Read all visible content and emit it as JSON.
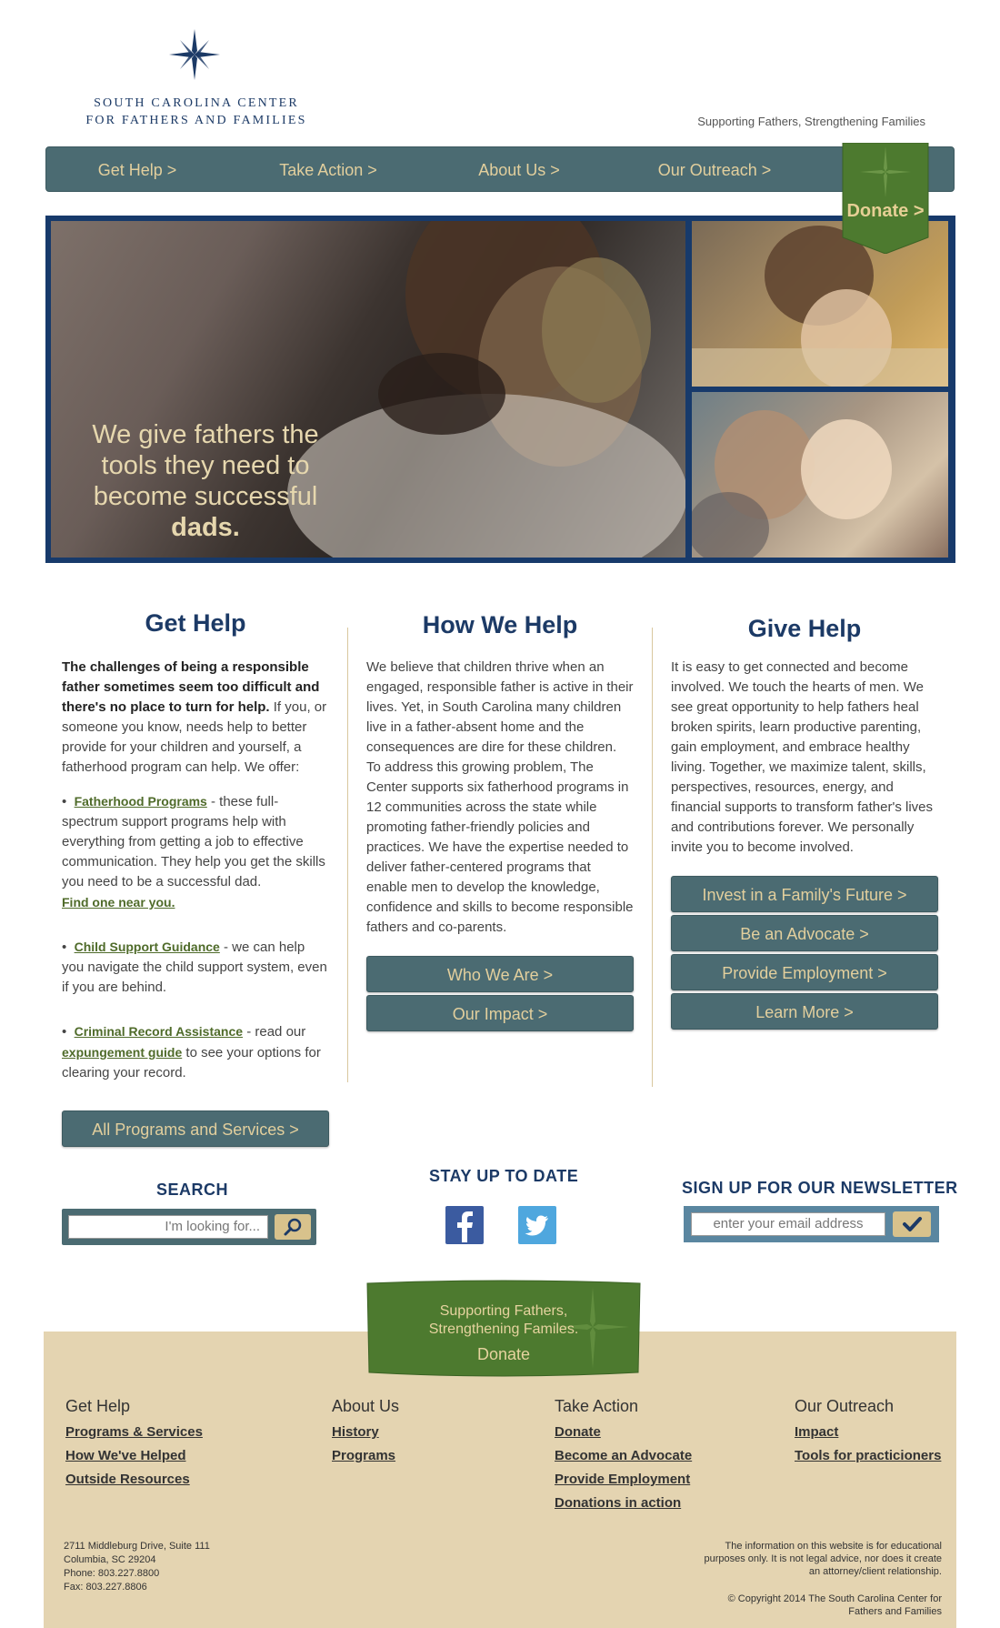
{
  "logo": {
    "line1": "SOUTH CAROLINA CENTER",
    "line2": "FOR FATHERS AND FAMILIES"
  },
  "tagline": "Supporting Fathers, Strengthening Families",
  "nav": {
    "items": [
      "Get Help >",
      "Take Action >",
      "About Us >",
      "Our Outreach >"
    ],
    "donate": "Donate >"
  },
  "hero": {
    "caption": "We give fathers the tools they need to become successful",
    "caption_bold": "dads."
  },
  "get_help": {
    "title": "Get Help",
    "intro_bold": "The challenges of being a responsible father sometimes seem too difficult and there's no place to turn for help.",
    "intro_rest": " If you, or someone you know, needs help to better provide for your children and yourself, a fatherhood program can help.  We offer:",
    "b1_link": "Fatherhood Programs",
    "b1_text": " - these full-spectrum support programs help with everything from getting a job to effective communication.  They help you get the skills you need to be a successful dad.",
    "b1_link2": "Find one near you.",
    "b2_link": "Child Support Guidance",
    "b2_text": " - we can help you navigate the child support system, even if you are behind.",
    "b3_link": "Criminal Record Assistance",
    "b3_text": " - read our ",
    "b3_link2": "expungement guide",
    "b3_text2": " to see your options for clearing your record.",
    "button": "All Programs and Services >"
  },
  "how_we_help": {
    "title": "How We Help",
    "body": "We believe that children thrive when an engaged, responsible father is active in their lives. Yet, in South Carolina many children live in a father-absent home and the consequences are dire for these children. To address this growing problem, The Center supports six fatherhood programs in 12 communities across the state while promoting father-friendly policies and practices.  We have the expertise needed to deliver father-centered programs that enable men to develop the knowledge, confidence and skills to become responsible fathers and co-parents.",
    "buttons": [
      "Who We Are >",
      "Our Impact >"
    ]
  },
  "give_help": {
    "title": "Give Help",
    "body": "It is easy to get connected and become involved. We touch the hearts of men. We see great opportunity to help fathers heal broken spirits, learn productive parenting, gain employment, and embrace healthy living.  Together, we maximize talent, skills, perspectives, resources, energy, and financial supports to transform father's lives and contributions forever.  We personally invite you to become involved.",
    "buttons": [
      "Invest in a Family's Future >",
      "Be an Advocate >",
      "Provide Employment >",
      "Learn More >"
    ]
  },
  "search": {
    "title": "SEARCH",
    "placeholder": "I'm looking for..."
  },
  "social": {
    "title": "STAY UP TO DATE"
  },
  "newsletter": {
    "title": "SIGN UP FOR OUR NEWSLETTER",
    "placeholder": "enter your email address"
  },
  "banner": {
    "line1": "Supporting Fathers,",
    "line2": "Strengthening Familes.",
    "donate": "Donate"
  },
  "footer": {
    "cols": [
      {
        "title": "Get Help",
        "links": [
          "Programs & Services",
          "How We've Helped",
          "Outside Resources"
        ]
      },
      {
        "title": "About Us",
        "links": [
          "History",
          "Programs"
        ]
      },
      {
        "title": "Take Action",
        "links": [
          "Donate",
          "Become an Advocate",
          "Provide Employment",
          "Donations in action"
        ]
      },
      {
        "title": "Our Outreach",
        "links": [
          "Impact",
          "Tools for practicioners"
        ]
      }
    ],
    "address": [
      "2711 Middleburg Drive, Suite 111",
      "Columbia, SC 29204",
      "Phone: 803.227.8800",
      "Fax: 803.227.8806"
    ],
    "legal": "The information on this website is for educational purposes only. It is not legal advice, nor does it create an attorney/client relationship.",
    "copyright": "© Copyright 2014 The South Carolina Center for Fathers and Families"
  },
  "colors": {
    "nav": "#4b6b72",
    "gold": "#e2cf9d",
    "navy": "#1c3a66",
    "green": "#4d7a2f",
    "footer": "#e4d4b1"
  }
}
